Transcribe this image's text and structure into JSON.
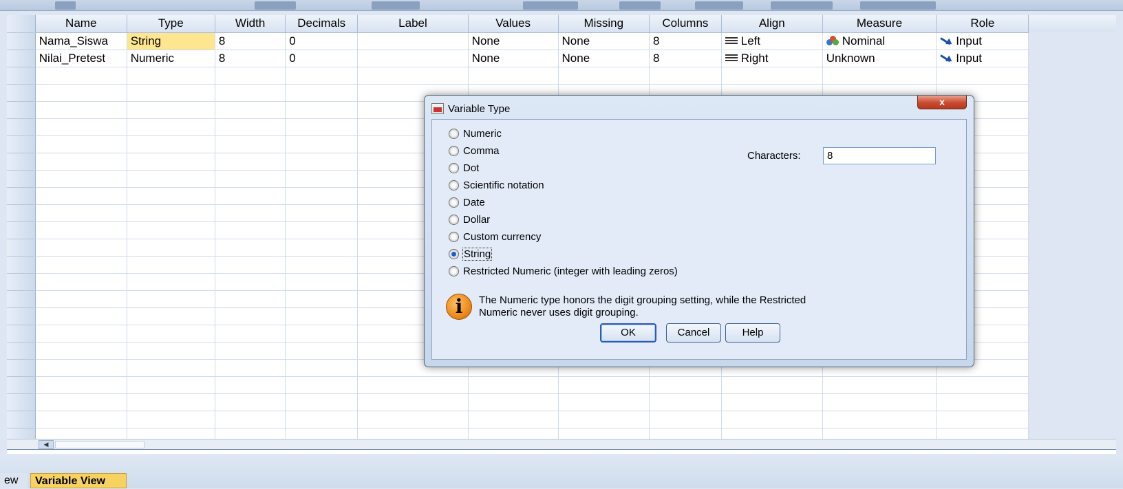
{
  "grid": {
    "columns": [
      "Name",
      "Type",
      "Width",
      "Decimals",
      "Label",
      "Values",
      "Missing",
      "Columns",
      "Align",
      "Measure",
      "Role"
    ],
    "rows": [
      {
        "name": "Nama_Siswa",
        "type": "String",
        "width": "8",
        "decimals": "0",
        "label": "",
        "values": "None",
        "missing": "None",
        "columns": "8",
        "align": "Left",
        "measure": "Nominal",
        "role": "Input"
      },
      {
        "name": "Nilai_Pretest",
        "type": "Numeric",
        "width": "8",
        "decimals": "0",
        "label": "",
        "values": "None",
        "missing": "None",
        "columns": "8",
        "align": "Right",
        "measure": "Unknown",
        "role": "Input"
      }
    ],
    "highlight_color": "#fde68f"
  },
  "tabs": {
    "data_view_partial": "ew",
    "variable_view": "Variable View"
  },
  "dialog": {
    "title": "Variable Type",
    "close_label": "x",
    "options": [
      {
        "label": "Numeric",
        "selected": false
      },
      {
        "label": "Comma",
        "selected": false
      },
      {
        "label": "Dot",
        "selected": false
      },
      {
        "label": "Scientific notation",
        "selected": false
      },
      {
        "label": "Date",
        "selected": false
      },
      {
        "label": "Dollar",
        "selected": false
      },
      {
        "label": "Custom currency",
        "selected": false
      },
      {
        "label": "String",
        "selected": true
      },
      {
        "label": "Restricted Numeric (integer with leading zeros)",
        "selected": false
      }
    ],
    "characters_label": "Characters:",
    "characters_value": "8",
    "info_line1": "The Numeric type honors the digit grouping setting, while the Restricted",
    "info_line2": "Numeric never uses digit grouping.",
    "ok_label": "OK",
    "cancel_label": "Cancel",
    "help_label": "Help"
  }
}
